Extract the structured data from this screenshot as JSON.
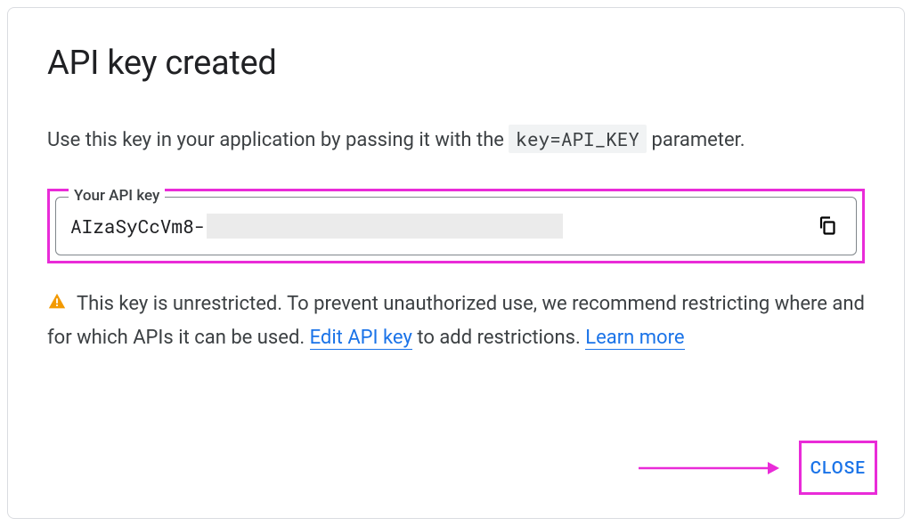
{
  "dialog": {
    "title": "API key created",
    "description_before": "Use this key in your application by passing it with the ",
    "description_code": "key=API_KEY",
    "description_after": " parameter."
  },
  "api_key": {
    "legend": "Your API key",
    "value_prefix": "AIzaSyCcVm8-"
  },
  "warning": {
    "text_before": "This key is unrestricted. To prevent unauthorized use, we recommend restricting where and for which APIs it can be used. ",
    "edit_link": "Edit API key",
    "text_middle": " to add restrictions. ",
    "learn_link": "Learn more"
  },
  "actions": {
    "close": "CLOSE"
  }
}
